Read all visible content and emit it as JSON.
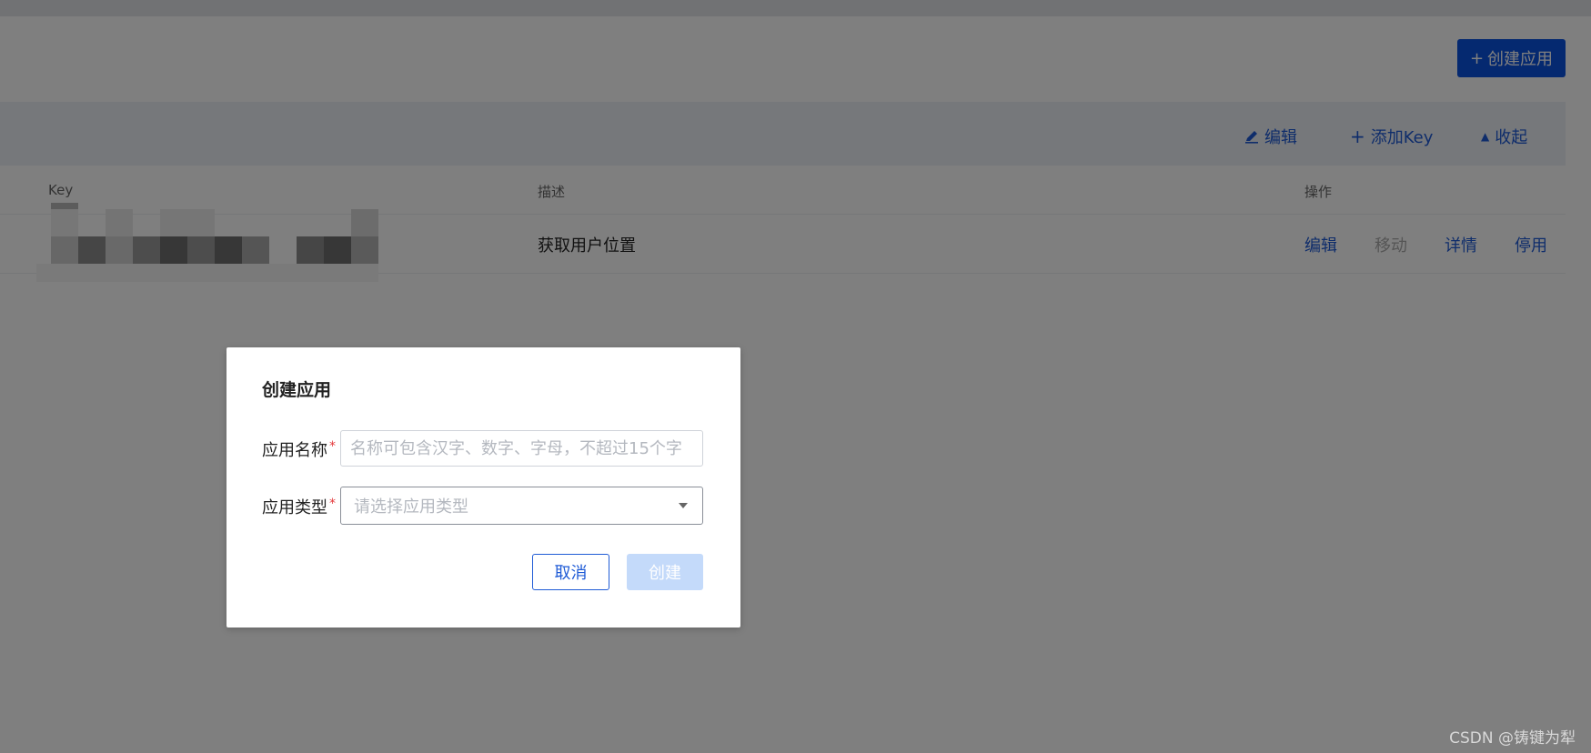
{
  "toolbar": {
    "create_app_label": "创建应用",
    "create_app_icon": "plus-icon"
  },
  "panel_header": {
    "actions": [
      {
        "label": "编辑",
        "icon": "edit-icon"
      },
      {
        "label": "添加Key",
        "icon": "plus-icon"
      },
      {
        "label": "收起",
        "icon": "caret-up-icon"
      }
    ]
  },
  "table": {
    "columns": [
      "Key",
      "描述",
      "操作"
    ],
    "rows": [
      {
        "description": "获取用户位置",
        "ops": [
          "编辑",
          "移动",
          "详情",
          "停用"
        ]
      }
    ]
  },
  "modal": {
    "title": "创建应用",
    "fields": [
      {
        "label": "应用名称",
        "required": "*",
        "placeholder": "名称可包含汉字、数字、字母，不超过15个字"
      },
      {
        "label": "应用类型",
        "required": "*",
        "placeholder": "请选择应用类型"
      }
    ],
    "cancel_label": "取消",
    "submit_label": "创建"
  },
  "watermark": "CSDN @铸键为犁",
  "colors": {
    "primary": "#0b52e0",
    "link": "#1f5bd6",
    "disabled_button": "#c4dafa",
    "required": "#e4393c"
  }
}
